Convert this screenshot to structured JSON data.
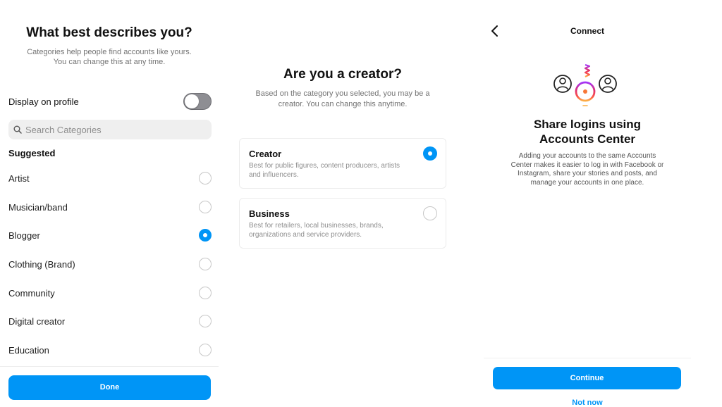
{
  "category_screen": {
    "title": "What best describes you?",
    "subtitle_lines": [
      "Categories help people find accounts like yours.",
      "You can change this at any time."
    ],
    "display_on_profile": {
      "label": "Display on profile",
      "enabled": false
    },
    "search": {
      "placeholder": "Search Categories",
      "value": ""
    },
    "suggested_heading": "Suggested",
    "categories": [
      {
        "label": "Artist",
        "selected": false
      },
      {
        "label": "Musician/band",
        "selected": false
      },
      {
        "label": "Blogger",
        "selected": true
      },
      {
        "label": "Clothing (Brand)",
        "selected": false
      },
      {
        "label": "Community",
        "selected": false
      },
      {
        "label": "Digital creator",
        "selected": false
      },
      {
        "label": "Education",
        "selected": false
      }
    ],
    "done_label": "Done"
  },
  "creator_screen": {
    "title": "Are you a creator?",
    "subtitle_lines": [
      "Based on the category you selected, you may be a",
      "creator. You can change this anytime."
    ],
    "options": [
      {
        "title": "Creator",
        "desc_lines": [
          "Best for public figures, content producers, artists",
          "and influencers."
        ],
        "selected": true
      },
      {
        "title": "Business",
        "desc_lines": [
          "Best for retailers, local businesses, brands,",
          "organizations and service providers."
        ],
        "selected": false
      }
    ]
  },
  "connect_screen": {
    "header": "Connect",
    "back_icon": "chevron-left-icon",
    "illustration_icon": "accounts-key-icon",
    "title_lines": [
      "Share logins using",
      "Accounts Center"
    ],
    "body_lines": [
      "Adding your accounts to the same Accounts",
      "Center makes it easier to log in with Facebook or",
      "Instagram, share your stories and posts, and",
      "manage your accounts in one place."
    ],
    "continue_label": "Continue",
    "not_now_label": "Not now"
  },
  "colors": {
    "accent": "#0095f6",
    "toggle_off": "#8e8e93",
    "muted_text": "#737373"
  }
}
